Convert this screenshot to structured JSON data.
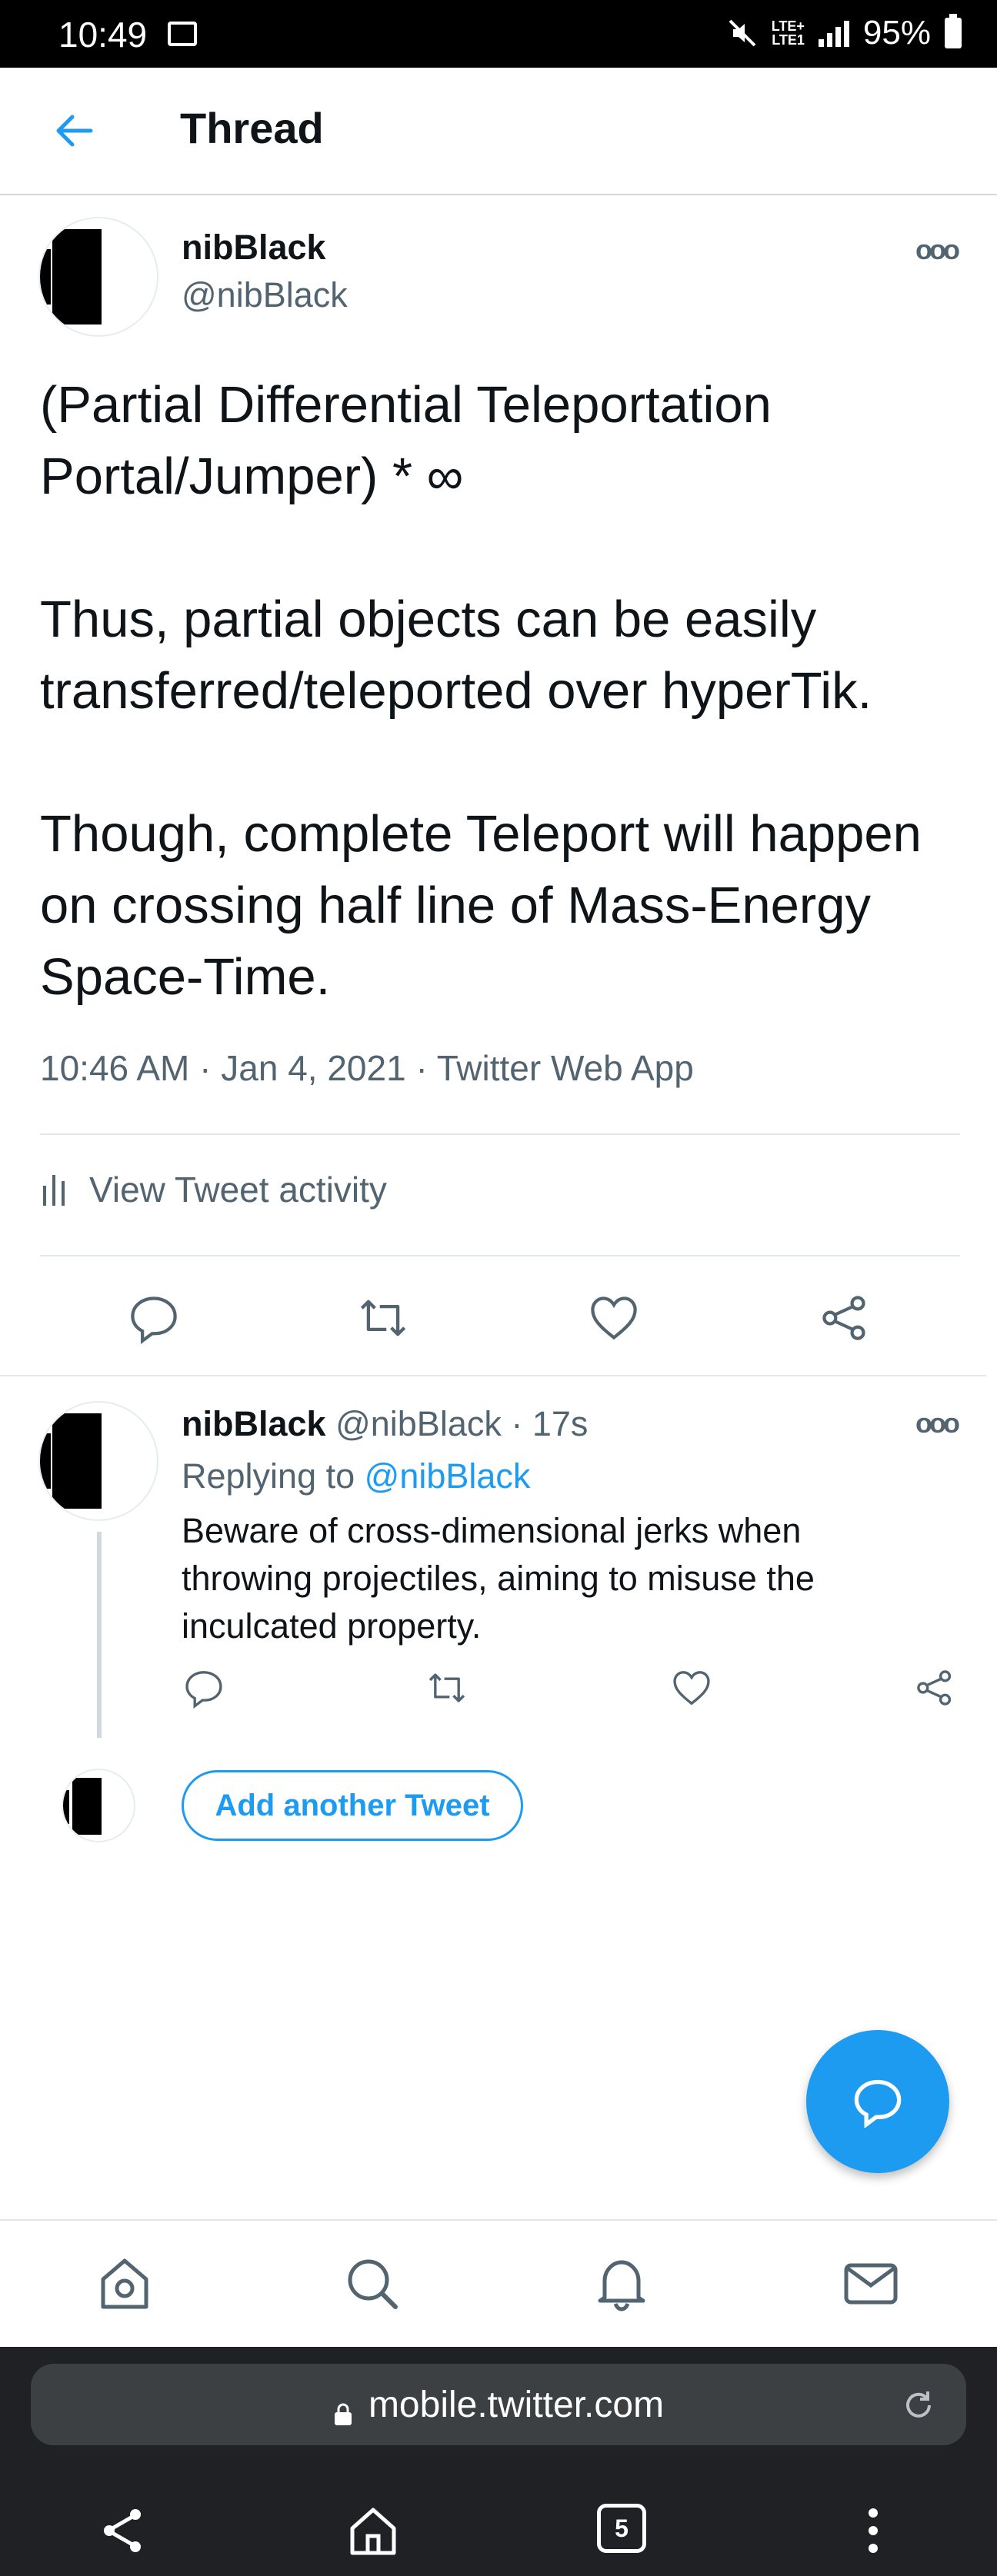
{
  "status_bar": {
    "time": "10:49",
    "network": "LTE+",
    "network_sub": "LTE1",
    "battery": "95%"
  },
  "header": {
    "title": "Thread"
  },
  "main_tweet": {
    "display_name": "nibBlack",
    "handle": "@nibBlack",
    "text": "(Partial Differential Teleportation Portal/Jumper) * ∞\n\nThus, partial objects can be easily transferred/teleported over hyperTik.\n\nThough, complete Teleport will happen on crossing half line of Mass-Energy Space-Time.",
    "time": "10:46 AM",
    "date": "Jan 4, 2021",
    "source": "Twitter Web App",
    "activity_label": "View Tweet activity"
  },
  "reply_tweet": {
    "display_name": "nibBlack",
    "handle": "@nibBlack",
    "age": "17s",
    "replying_prefix": "Replying to",
    "replying_to": "@nibBlack",
    "text": "Beware of cross-dimensional jerks when throwing projectiles, aiming to misuse the inculcated property."
  },
  "compose": {
    "add_label": "Add another Tweet"
  },
  "browser": {
    "url": "mobile.twitter.com",
    "tab_count": "5"
  },
  "colors": {
    "accent": "#1d9bf0",
    "text": "#0f1419",
    "muted": "#536471"
  },
  "icons": {
    "back": "arrow-left-icon",
    "more": "more-icon",
    "reply": "reply-icon",
    "retweet": "retweet-icon",
    "like": "heart-icon",
    "share": "share-icon",
    "home": "home-icon",
    "search": "search-icon",
    "notifications": "bell-icon",
    "messages": "mail-icon"
  }
}
